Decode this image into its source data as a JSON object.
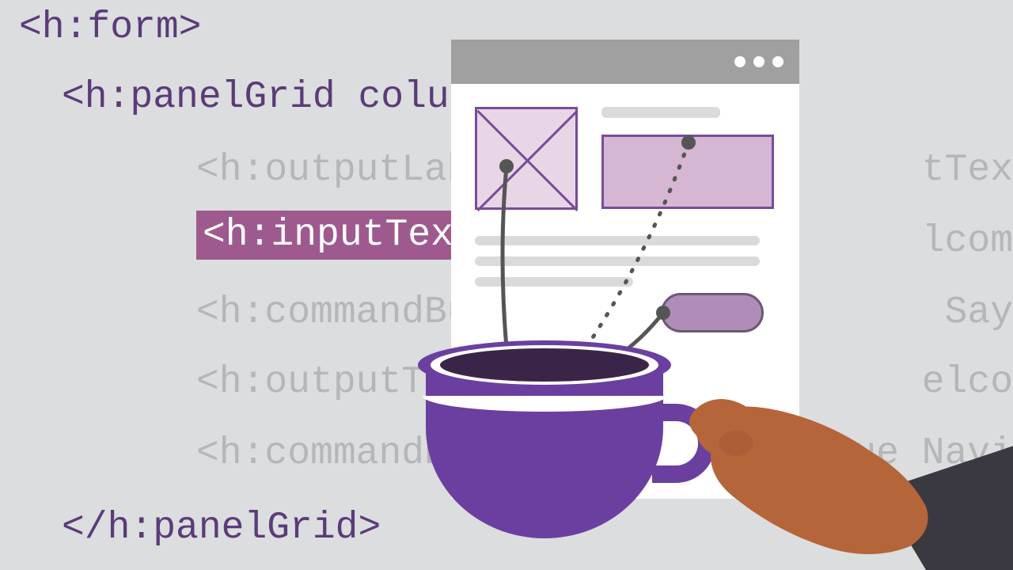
{
  "code": {
    "line1": "<h:form>",
    "line2": "<h:panelGrid column",
    "line3": "<h:outputLab",
    "line4": "<h:inputText",
    "line5": "<h:commandBu",
    "line6": "<h:outputTe",
    "line7": "<h:commandB",
    "line8": "</h:panelGrid>"
  },
  "right_fragments": {
    "r1": "tTex",
    "r2": "lcom",
    "r3": "Say",
    "r4": "elco",
    "r5": "ue  Navi"
  },
  "illustration": {
    "browser": "browser-window-mockup",
    "wireframe_image": "image-placeholder-x",
    "wireframe_input": "input-field-rectangle",
    "wireframe_button": "button-pill",
    "cup": "java-coffee-cup",
    "hand": "human-hand-holding-cup"
  },
  "colors": {
    "bg": "#dcddde",
    "purple_dark": "#5a3b7a",
    "purple_cup": "#6b3fa0",
    "highlight": "#9e5a8e",
    "gray_text": "#b5b6b8",
    "wireframe_border": "#7a4b9a"
  }
}
